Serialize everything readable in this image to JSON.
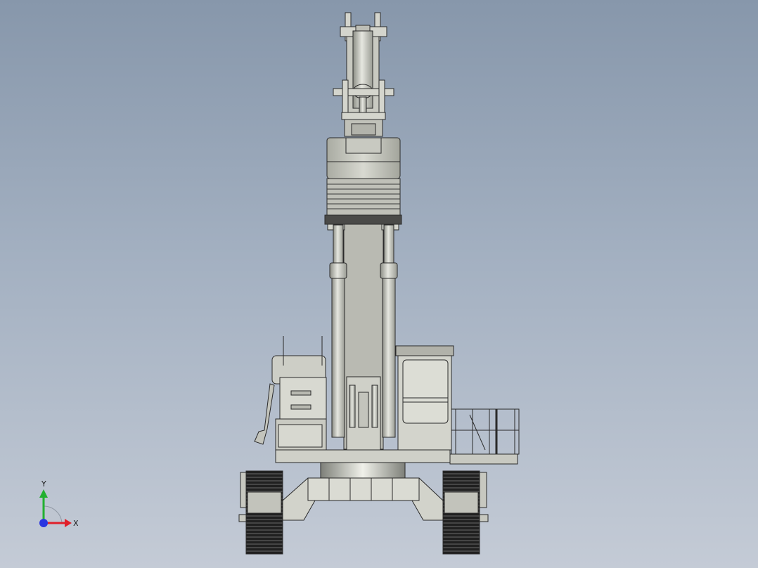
{
  "viewport": {
    "background_top": "#8797ab",
    "background_bottom": "#c4cbd6",
    "model_fill": "#d4d5cd",
    "model_stroke": "#2a2a2a",
    "track_fill": "#1c1c1c"
  },
  "triad": {
    "x_label": "X",
    "y_label": "Y",
    "x_color": "#e0202a",
    "y_color": "#22b030",
    "z_color": "#2a36e0"
  }
}
